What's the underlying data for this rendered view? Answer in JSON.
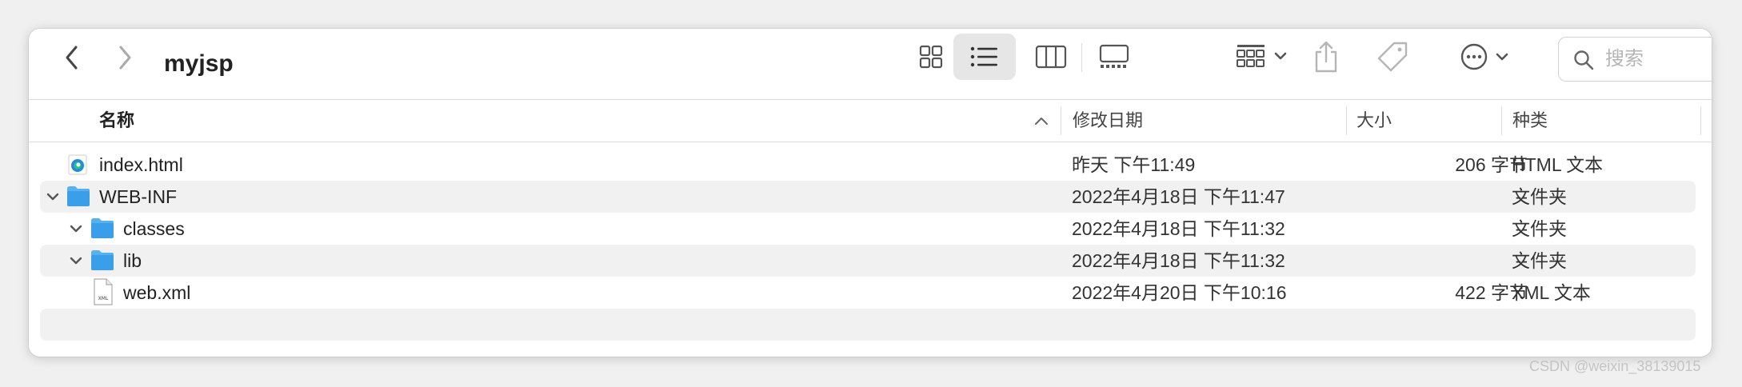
{
  "window": {
    "title": "myjsp"
  },
  "toolbar": {
    "search_placeholder": "搜索",
    "icons": [
      "back-arrow-icon",
      "forward-arrow-icon",
      "icon-view-icon",
      "list-view-icon",
      "column-view-icon",
      "gallery-view-icon",
      "group-icon",
      "share-icon",
      "tag-icon",
      "more-icon",
      "search-icon"
    ]
  },
  "columns": {
    "name": "名称",
    "modified": "修改日期",
    "size": "大小",
    "kind": "种类"
  },
  "files": [
    {
      "name": "index.html",
      "modified": "昨天 下午11:49",
      "size": "206 字节",
      "kind": "HTML 文本"
    },
    {
      "name": "WEB-INF",
      "modified": "2022年4月18日 下午11:47",
      "size": "--",
      "kind": "文件夹"
    },
    {
      "name": "classes",
      "modified": "2022年4月18日 下午11:32",
      "size": "--",
      "kind": "文件夹"
    },
    {
      "name": "lib",
      "modified": "2022年4月18日 下午11:32",
      "size": "--",
      "kind": "文件夹"
    },
    {
      "name": "web.xml",
      "modified": "2022年4月20日 下午10:16",
      "size": "422 字节",
      "kind": "XML 文本"
    }
  ],
  "xml_icon_label": "XML",
  "watermark": "CSDN @weixin_38139015",
  "colors": {
    "folder": "#3a9ee8",
    "row_alt": "#f1f1f1",
    "text": "#222222"
  }
}
